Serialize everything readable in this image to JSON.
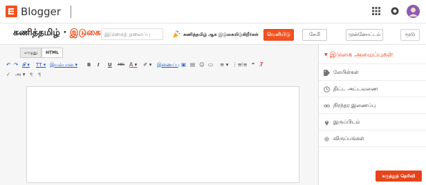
{
  "header": {
    "brand": "Blogger",
    "apps_icon": "apps-grid-icon",
    "notifications_icon": "notification-icon",
    "account_icon": "account-avatar"
  },
  "post": {
    "blog_name": "கணித்தமிழ் · ",
    "section_name": "இடுகை",
    "title_placeholder": "இடுகைத் தலைப்பு",
    "promo_text": "கணித்தமிழ் ஆக இடுகையிடுகிறீர்கள்",
    "publish_label": "வெளியிடு",
    "save_label": "சேமி",
    "preview_label": "முன்னோட்டம்",
    "close_label": "மூடு"
  },
  "editor": {
    "tabs": [
      "எழுது",
      "HTML"
    ],
    "toolbar": {
      "undo": "↶",
      "redo": "↷",
      "font_family": "𝓕 ▾",
      "font_size": "𝖳T ▾",
      "format": "இயல்பான ▾",
      "bold": "B",
      "italic": "I",
      "underline": "U",
      "strike": "ABC",
      "text_color": "A ▾",
      "highlight": "✐ ▾",
      "link": "இணைப்பு",
      "image": "▣",
      "video": "▤",
      "emoji": "☺",
      "jump_break": "▭",
      "align": "≡ ▾",
      "numbered_list": "⋮≡",
      "bullet_list": "⁝≡",
      "quote": "❝",
      "clear_format": "T̸",
      "spellcheck": "✓",
      "input_tools": "அ ▾",
      "ltr": "¶",
      "rtl": "¶"
    }
  },
  "sidebar": {
    "heading": "இடுகை அமைப்புகள்",
    "items": [
      {
        "icon": "tag-icon",
        "label": "லேபிள்கள்"
      },
      {
        "icon": "clock-icon",
        "label": "திட்ட அட்டவணை"
      },
      {
        "icon": "link-icon",
        "label": "நிரந்தர இணைப்பு"
      },
      {
        "icon": "location-pin-icon",
        "label": "இருப்பிடம்"
      },
      {
        "icon": "gear-icon",
        "label": "விருப்பங்கள்"
      }
    ],
    "help_label": "கருத்துத் தெரிவி"
  },
  "colors": {
    "accent": "#f4511e",
    "link": "#1a55c8"
  }
}
